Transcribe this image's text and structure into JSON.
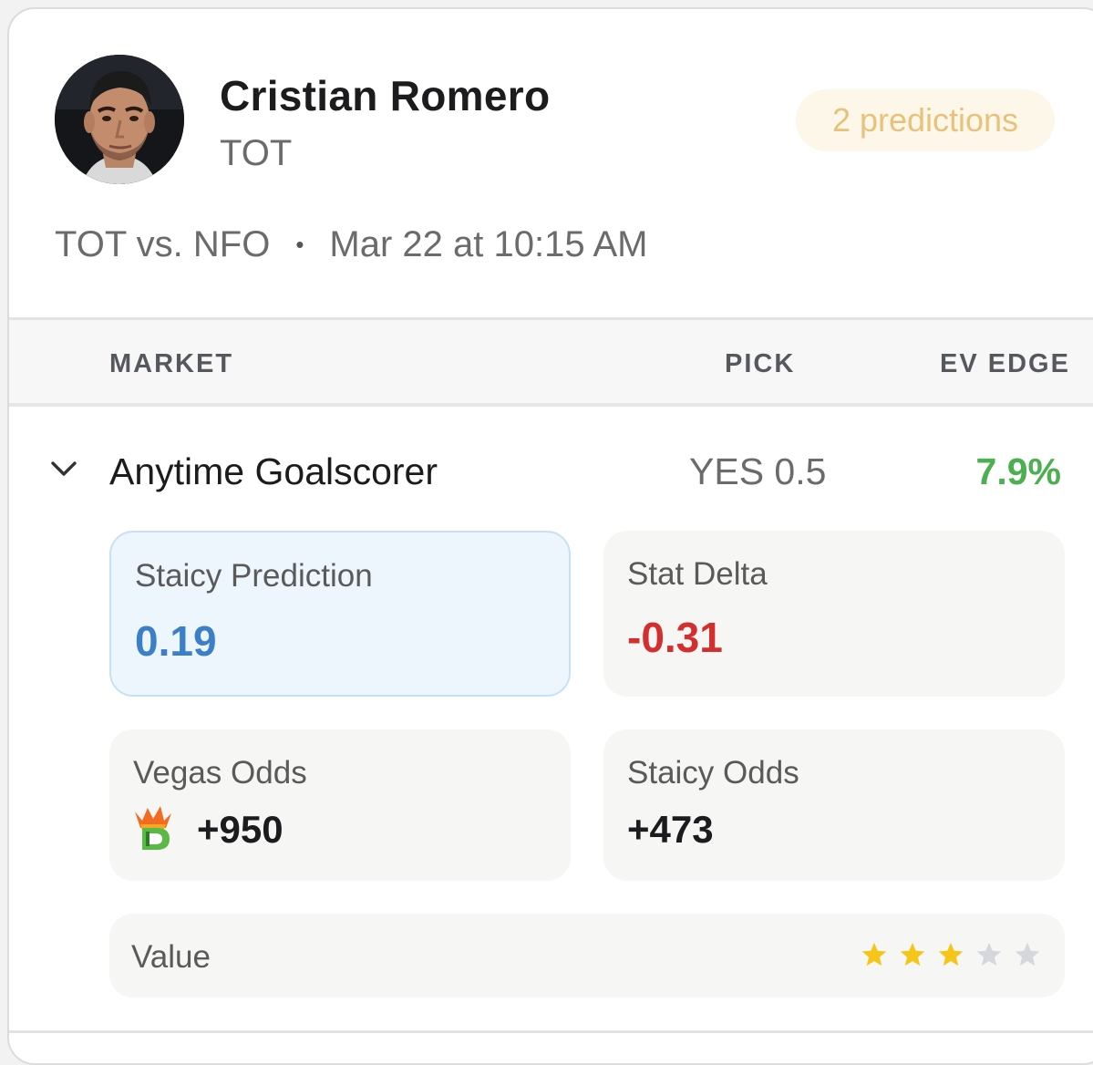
{
  "player": {
    "name": "Cristian Romero",
    "team": "TOT",
    "predictions_badge": "2 predictions"
  },
  "match": {
    "teams": "TOT vs. NFO",
    "separator": "•",
    "datetime": "Mar 22 at 10:15 AM"
  },
  "table": {
    "headers": {
      "market": "MARKET",
      "pick": "PICK",
      "ev_edge": "EV EDGE"
    },
    "row": {
      "market": "Anytime Goalscorer",
      "pick": "YES 0.5",
      "ev_edge": "7.9%",
      "expand_icon": "chevron-down-icon"
    }
  },
  "details": {
    "staicy_prediction": {
      "label": "Staicy Prediction",
      "value": "0.19"
    },
    "stat_delta": {
      "label": "Stat Delta",
      "value": "-0.31"
    },
    "vegas_odds": {
      "label": "Vegas Odds",
      "value": "+950",
      "book_icon": "draftkings-logo-icon"
    },
    "staicy_odds": {
      "label": "Staicy Odds",
      "value": "+473"
    },
    "value_rating": {
      "label": "Value",
      "stars_filled": 3,
      "stars_total": 5
    }
  },
  "colors": {
    "edge_positive": "#4caf50",
    "prediction_blue": "#3a7fc7",
    "delta_negative": "#d32f2f",
    "badge_text": "#e8c27a",
    "star_filled": "#f5c518",
    "star_empty": "#d5d7dc"
  }
}
